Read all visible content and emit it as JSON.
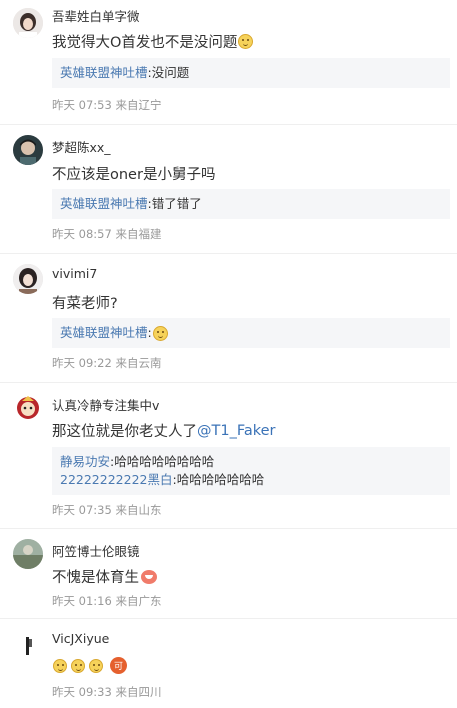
{
  "comments": [
    {
      "username": "吾辈姓白单字微",
      "content": "我觉得大O首发也不是没问题",
      "reply": {
        "author": "英雄联盟神吐槽",
        "text": "没问题"
      },
      "meta": "昨天 07:53 来自辽宁"
    },
    {
      "username": "梦超陈xx_",
      "content": "不应该是oner是小舅子吗",
      "reply": {
        "author": "英雄联盟神吐槽",
        "text": "错了错了"
      },
      "meta": "昨天 08:57 来自福建"
    },
    {
      "username": "vivimi7",
      "content": "有菜老师?",
      "reply": {
        "author": "英雄联盟神吐槽",
        "text": ""
      },
      "meta": "昨天 09:22 来自云南"
    },
    {
      "username": "认真冷静专注集中v",
      "content": "那这位就是你老丈人了",
      "mention": "@T1_Faker",
      "replies": [
        {
          "author": "静易功安",
          "text": "哈哈哈哈哈哈哈哈"
        },
        {
          "author": "22222222222黑白",
          "text": "哈哈哈哈哈哈哈"
        }
      ],
      "meta": "昨天 07:35 来自山东"
    },
    {
      "username": "阿笠博士伦眼镜",
      "content": "不愧是体育生",
      "meta": "昨天 01:16 来自广东"
    },
    {
      "username": "VicJXiyue",
      "badge": "可",
      "meta": "昨天 09:33 来自四川"
    }
  ],
  "icons": [
    "doge-emoji-icon",
    "laugh-emoji-icon",
    "fan-badge-icon"
  ]
}
